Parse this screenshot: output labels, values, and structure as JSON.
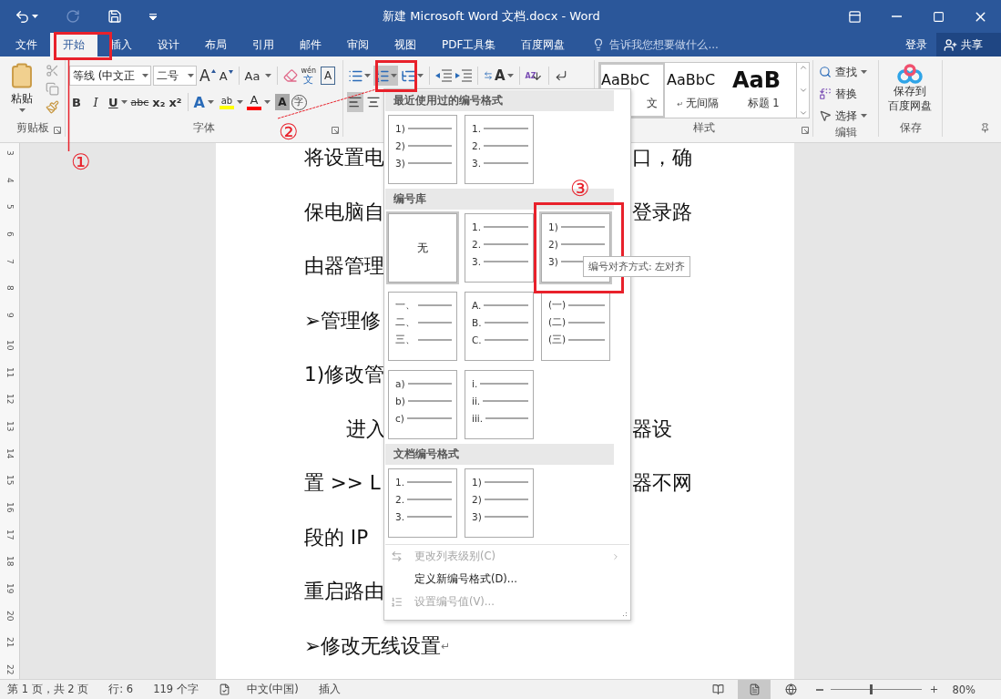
{
  "window": {
    "title": "新建 Microsoft Word 文档.docx - Word"
  },
  "quick_access": [
    {
      "kind": "undo",
      "disabled": false,
      "menu": true
    },
    {
      "kind": "redo",
      "disabled": true,
      "menu": false
    },
    {
      "kind": "save",
      "disabled": false,
      "menu": false
    },
    {
      "kind": "customize",
      "disabled": false,
      "menu": false
    }
  ],
  "tabs": [
    {
      "label": "文件",
      "selected": false
    },
    {
      "label": "开始",
      "selected": true
    },
    {
      "label": "插入",
      "selected": false
    },
    {
      "label": "设计",
      "selected": false
    },
    {
      "label": "布局",
      "selected": false
    },
    {
      "label": "引用",
      "selected": false
    },
    {
      "label": "邮件",
      "selected": false
    },
    {
      "label": "审阅",
      "selected": false
    },
    {
      "label": "视图",
      "selected": false
    },
    {
      "label": "PDF工具集",
      "selected": false
    },
    {
      "label": "百度网盘",
      "selected": false
    }
  ],
  "tell_me": {
    "placeholder": "告诉我您想要做什么..."
  },
  "account": {
    "sign_in": "登录",
    "share": "共享"
  },
  "ribbon": {
    "clipboard": {
      "paste": "粘贴",
      "label": "剪贴板"
    },
    "font": {
      "face": "等线 (中文正",
      "size": "二号",
      "label": "字体",
      "row1": [
        {
          "kind": "grow",
          "label": "A",
          "menu": false
        },
        {
          "kind": "shrink",
          "label": "A",
          "menu": false
        },
        {
          "kind": "separator"
        },
        {
          "kind": "case",
          "label": "Aa",
          "menu": true
        },
        {
          "kind": "separator"
        },
        {
          "kind": "clear",
          "menu": false
        },
        {
          "kind": "phonetic",
          "ruby": "wén",
          "label": "文",
          "menu": false
        },
        {
          "kind": "border",
          "label": "A",
          "menu": false
        }
      ],
      "row2": [
        {
          "kind": "bold",
          "label": "B",
          "menu": false
        },
        {
          "kind": "italic",
          "label": "I",
          "menu": false
        },
        {
          "kind": "underline",
          "label": "U",
          "menu": true
        },
        {
          "kind": "strike",
          "label": "abc",
          "menu": false
        },
        {
          "kind": "sub",
          "label": "x₂",
          "menu": false
        },
        {
          "kind": "sup",
          "label": "x²",
          "menu": false
        },
        {
          "kind": "separator"
        },
        {
          "kind": "effect",
          "label": "A",
          "menu": true
        },
        {
          "kind": "highlight",
          "label": "ab",
          "menu": true
        },
        {
          "kind": "color",
          "label": "A",
          "menu": true
        },
        {
          "kind": "shading",
          "label": "A",
          "menu": false
        },
        {
          "kind": "enclose",
          "label": "字",
          "menu": false
        }
      ]
    },
    "paragraph": {
      "row1": [
        {
          "kind": "bullets",
          "menu": true,
          "pressed": false
        },
        {
          "kind": "numbering",
          "menu": true,
          "pressed": true
        },
        {
          "kind": "multilevel",
          "menu": true,
          "pressed": false
        },
        {
          "kind": "separator"
        },
        {
          "kind": "outdent",
          "menu": false,
          "pressed": false
        },
        {
          "kind": "indent",
          "menu": false,
          "pressed": false
        },
        {
          "kind": "separator"
        },
        {
          "kind": "layout",
          "label": "A",
          "menu": true,
          "pressed": false
        },
        {
          "kind": "separator"
        },
        {
          "kind": "sort",
          "label": "AZ",
          "menu": false,
          "pressed": false
        },
        {
          "kind": "separator"
        },
        {
          "kind": "marks",
          "menu": false,
          "pressed": false
        }
      ],
      "row2": [
        {
          "kind": "align-left",
          "menu": false,
          "pressed": true
        },
        {
          "kind": "align-center",
          "menu": false,
          "pressed": false
        }
      ]
    },
    "styles": {
      "label": "样式",
      "items": [
        {
          "preview": "AaBbC",
          "name": "文",
          "kind": "body",
          "selected": true,
          "covered": true
        },
        {
          "preview": "AaBbC",
          "name": "无间隔",
          "mark": "↵",
          "kind": "body",
          "selected": false,
          "covered": false
        },
        {
          "preview": "AaB",
          "name": "标题 1",
          "kind": "heading",
          "selected": false,
          "covered": false
        }
      ]
    },
    "editing": {
      "label": "编辑",
      "items": [
        {
          "kind": "find",
          "label": "查找",
          "menu": true
        },
        {
          "kind": "replace",
          "label": "替换",
          "menu": false
        },
        {
          "kind": "select",
          "label": "选择",
          "menu": true
        }
      ]
    },
    "save": {
      "lines": [
        "保存到",
        "百度网盘"
      ],
      "label": "保存"
    }
  },
  "ruler": [
    "3",
    "4",
    "5",
    "6",
    "7",
    "8",
    "9",
    "10",
    "11",
    "12",
    "13",
    "14",
    "15",
    "16",
    "17",
    "18",
    "19",
    "20",
    "21",
    "22"
  ],
  "document": {
    "lines": [
      {
        "left": "将设置电",
        "right": "口，确",
        "indent": false
      },
      {
        "left": "保电脑自",
        "right": "登录路",
        "indent": false
      },
      {
        "left": "由器管理",
        "indent": false
      },
      {
        "left": "➢管理修",
        "indent": false
      },
      {
        "left": "1)修改管",
        "indent": false
      },
      {
        "left": "进入",
        "right": "器设",
        "indent": true
      },
      {
        "left": "置 >> L",
        "right": "器不网",
        "indent": false
      },
      {
        "left": "段的 IP",
        "indent": false
      },
      {
        "left": "重启路由",
        "indent": false
      },
      {
        "left": "➢修改无线设置",
        "mark": "↵",
        "indent": false
      }
    ]
  },
  "numbering_menu": {
    "sections": [
      {
        "title": "最近使用过的编号格式",
        "tiles": [
          {
            "kind": "list",
            "markers": [
              "1)",
              "2)",
              "3)"
            ],
            "highlighted": false
          },
          {
            "kind": "list",
            "markers": [
              "1.",
              "2.",
              "3."
            ],
            "highlighted": false
          }
        ]
      },
      {
        "title": "编号库",
        "tiles": [
          {
            "kind": "none",
            "label": "无",
            "highlighted": true
          },
          {
            "kind": "list",
            "markers": [
              "1.",
              "2.",
              "3."
            ],
            "highlighted": false
          },
          {
            "kind": "list",
            "markers": [
              "1)",
              "2)",
              "3)"
            ],
            "highlighted": true
          },
          {
            "kind": "list",
            "markers": [
              "一、",
              "二、",
              "三、"
            ],
            "highlighted": false
          },
          {
            "kind": "list",
            "markers": [
              "A.",
              "B.",
              "C."
            ],
            "highlighted": false
          },
          {
            "kind": "list",
            "markers": [
              "(一)",
              "(二)",
              "(三)"
            ],
            "highlighted": false
          },
          {
            "kind": "list",
            "markers": [
              "a)",
              "b)",
              "c)"
            ],
            "highlighted": false
          },
          {
            "kind": "list",
            "markers": [
              "i.",
              "ii.",
              "iii."
            ],
            "highlighted": false
          }
        ]
      },
      {
        "title": "文档编号格式",
        "tiles": [
          {
            "kind": "list",
            "markers": [
              "1.",
              "2.",
              "3."
            ],
            "highlighted": false
          },
          {
            "kind": "list",
            "markers": [
              "1)",
              "2)",
              "3)"
            ],
            "highlighted": false
          }
        ]
      }
    ],
    "items": [
      {
        "kind": "level",
        "label": "更改列表级别(C)",
        "disabled": true,
        "submenu": true
      },
      {
        "kind": "define",
        "label": "定义新编号格式(D)...",
        "disabled": false,
        "submenu": false
      },
      {
        "kind": "value",
        "label": "设置编号值(V)...",
        "disabled": true,
        "submenu": false
      }
    ],
    "tooltip": "编号对齐方式: 左对齐"
  },
  "annotations": [
    {
      "label": "①"
    },
    {
      "label": "②"
    },
    {
      "label": "③"
    }
  ],
  "status_bar": {
    "page": "第 1 页，共 2 页",
    "line": "行: 6",
    "words": "119 个字",
    "language": "中文(中国)",
    "mode": "插入",
    "views": [
      {
        "kind": "read",
        "selected": false
      },
      {
        "kind": "print",
        "selected": true
      },
      {
        "kind": "web",
        "selected": false
      }
    ],
    "zoom": {
      "level": 0.43,
      "reading": "80%"
    }
  }
}
